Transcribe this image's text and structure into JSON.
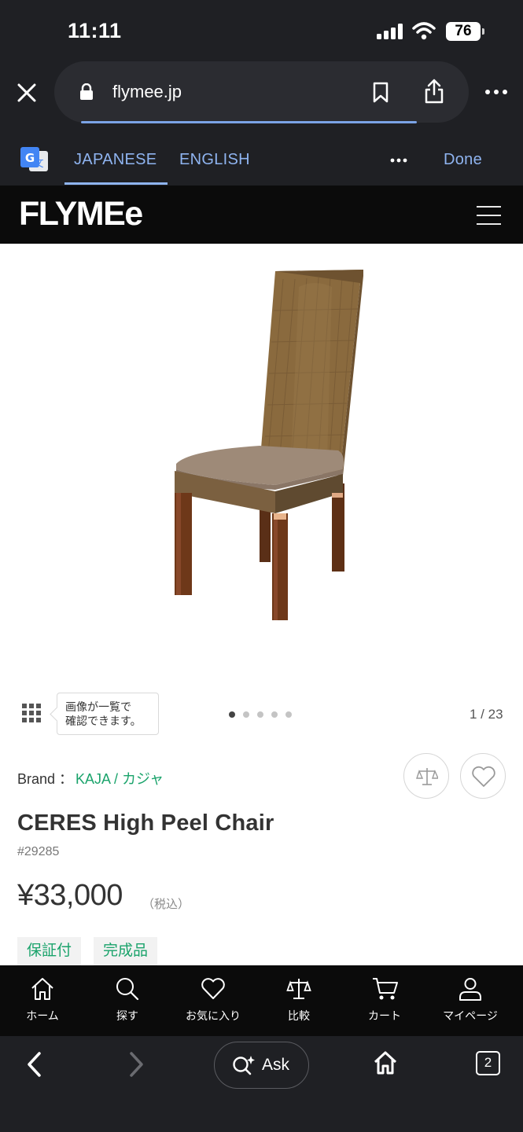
{
  "status_bar": {
    "time": "11:11",
    "battery": "76"
  },
  "browser": {
    "url": "flymee.jp",
    "load_progress": 0.81
  },
  "translate": {
    "tabs": [
      "JAPANESE",
      "ENGLISH"
    ],
    "active_tab": "JAPANESE",
    "done_label": "Done"
  },
  "site": {
    "logo": "FLYMEe"
  },
  "gallery": {
    "tooltip_line1": "画像が一覧で",
    "tooltip_line2": "確認できます。",
    "counter": "1 / 23",
    "dots_count": 5,
    "active_dot": 0
  },
  "product": {
    "brand_label": "Brand ：",
    "brand_name": "KAJA / カジャ",
    "title": "CERES High Peel Chair",
    "sku": "#29285",
    "price": "¥33,000",
    "tax_note": "（税込）",
    "tags": [
      "保証付",
      "完成品"
    ]
  },
  "site_nav": {
    "items": [
      {
        "label": "ホーム",
        "icon": "home-icon"
      },
      {
        "label": "探す",
        "icon": "search-icon"
      },
      {
        "label": "お気に入り",
        "icon": "heart-icon"
      },
      {
        "label": "比較",
        "icon": "scale-icon"
      },
      {
        "label": "カート",
        "icon": "cart-icon"
      },
      {
        "label": "マイページ",
        "icon": "user-icon"
      }
    ]
  },
  "toolbar": {
    "ask_label": "Ask",
    "tabs_count": "2"
  },
  "colors": {
    "accent_green": "#1aa36b",
    "link_blue": "#8fb4f0",
    "chrome_dark": "#1f2024"
  }
}
